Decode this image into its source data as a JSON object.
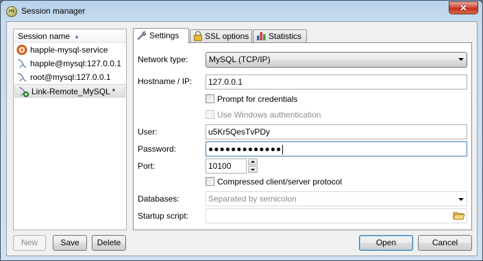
{
  "window": {
    "title": "Session manager",
    "app_icon_text": "HS",
    "close_glyph": "✕"
  },
  "sessions": {
    "header": "Session name",
    "items": [
      {
        "label": "happle-mysql-service",
        "icon": "pg-elephant-icon",
        "selected": false
      },
      {
        "label": "happle@mysql:127.0.0.1",
        "icon": "mysql-dolphin-icon",
        "selected": false
      },
      {
        "label": "root@mysql:127.0.0.1",
        "icon": "mysql-dolphin-icon",
        "selected": false
      },
      {
        "label": "Link-Remote_MySQL *",
        "icon": "mysql-dolphin-new-icon",
        "selected": true
      }
    ]
  },
  "tabs": [
    {
      "label": "Settings",
      "icon": "wrench-icon",
      "active": true
    },
    {
      "label": "SSL options",
      "icon": "lock-icon",
      "active": false
    },
    {
      "label": "Statistics",
      "icon": "bar-chart-icon",
      "active": false
    }
  ],
  "settings": {
    "network_type_label": "Network type:",
    "network_type_value": "MySQL (TCP/IP)",
    "hostname_label": "Hostname / IP:",
    "hostname_value": "127.0.0.1",
    "prompt_credentials_label": "Prompt for credentials",
    "windows_auth_label": "Use Windows authentication",
    "user_label": "User:",
    "user_value": "u5Kr5QesTvPDy",
    "password_label": "Password:",
    "password_value": "●●●●●●●●●●●●●",
    "port_label": "Port:",
    "port_value": "10100",
    "compressed_label": "Compressed client/server protocol",
    "databases_label": "Databases:",
    "databases_placeholder": "Separated by semicolon",
    "startup_script_label": "Startup script:",
    "startup_script_value": ""
  },
  "buttons": {
    "new": "New",
    "save": "Save",
    "delete": "Delete",
    "open": "Open",
    "cancel": "Cancel"
  }
}
